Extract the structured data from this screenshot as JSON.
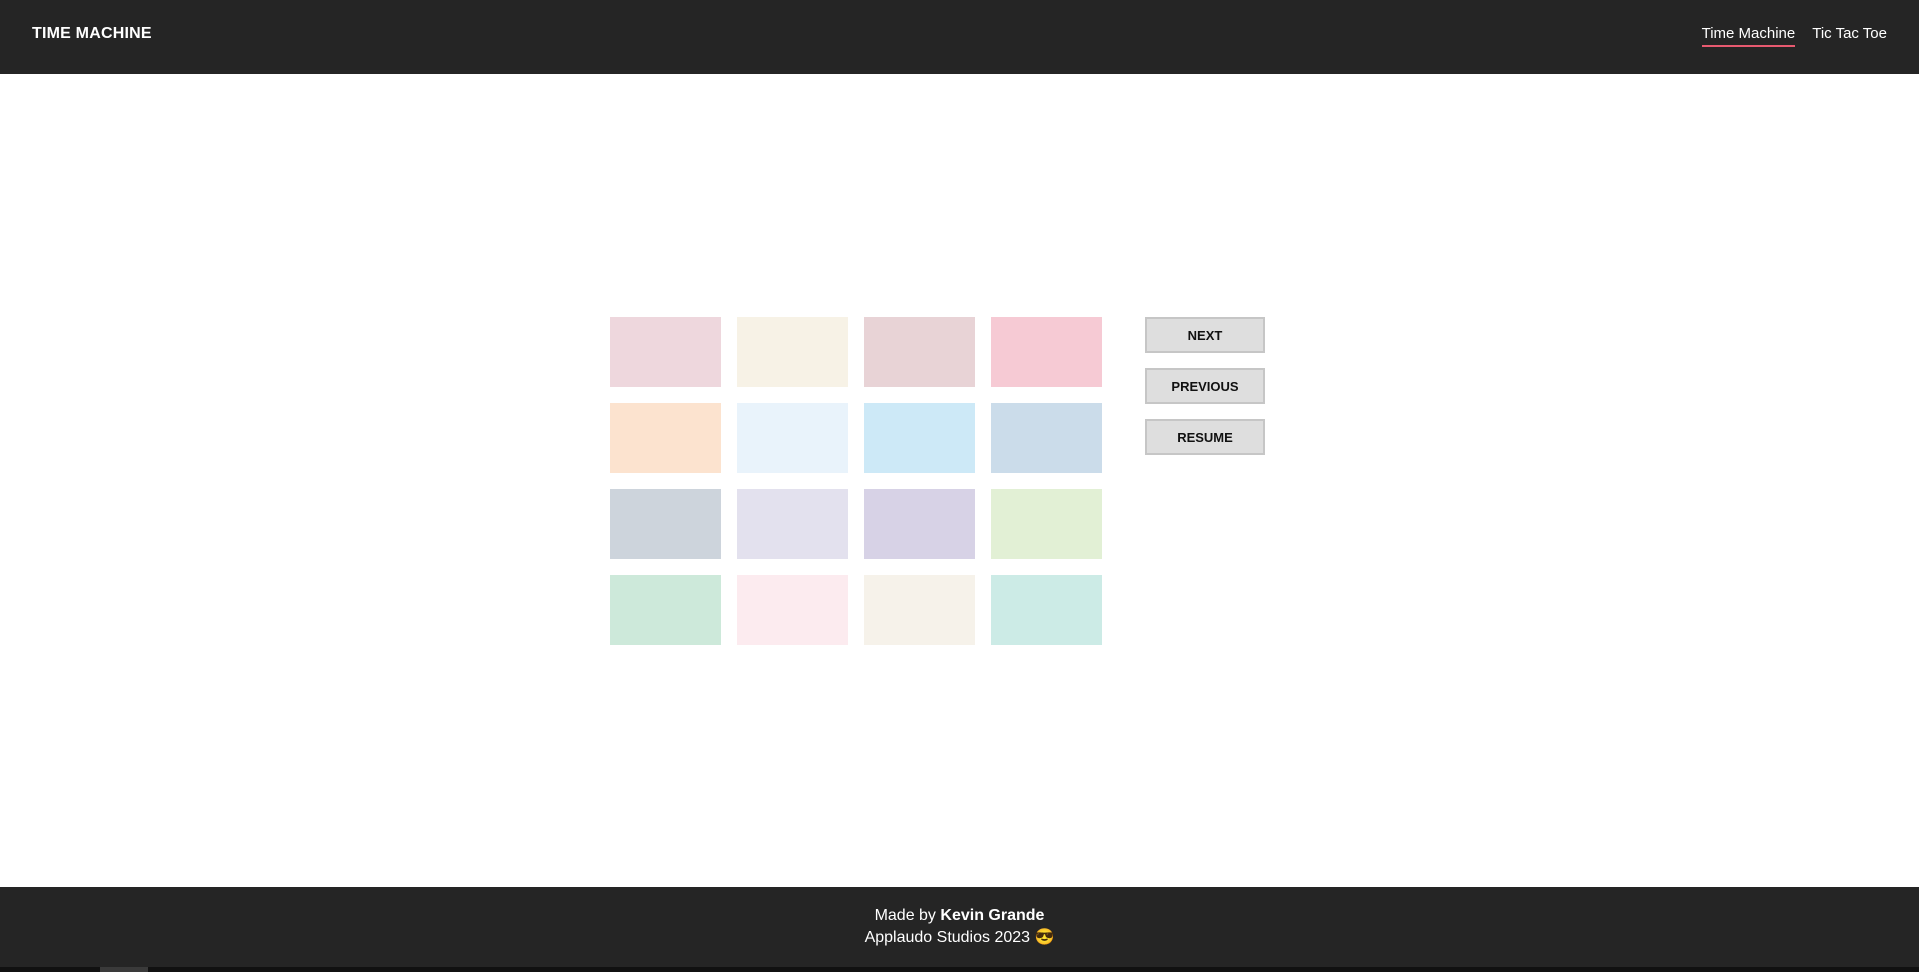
{
  "header": {
    "brand": "TIME MACHINE",
    "nav": [
      {
        "label": "Time Machine",
        "active": true
      },
      {
        "label": "Tic Tac Toe",
        "active": false
      }
    ],
    "active_underline_color": "#e85a70"
  },
  "grid": {
    "tiles": [
      {
        "color": "#eed7dd"
      },
      {
        "color": "#f7f2e6"
      },
      {
        "color": "#e8d3d6"
      },
      {
        "color": "#f6cad4"
      },
      {
        "color": "#fce3cf"
      },
      {
        "color": "#e9f3fb"
      },
      {
        "color": "#cde9f7"
      },
      {
        "color": "#cbdcea"
      },
      {
        "color": "#cdd4dc"
      },
      {
        "color": "#e3e1ee"
      },
      {
        "color": "#d7d2e6"
      },
      {
        "color": "#e2f0d5"
      },
      {
        "color": "#cde9da"
      },
      {
        "color": "#fcebef"
      },
      {
        "color": "#f6f2ea"
      },
      {
        "color": "#ccebe6"
      }
    ]
  },
  "controls": {
    "next_label": "NEXT",
    "previous_label": "PREVIOUS",
    "resume_label": "RESUME"
  },
  "footer": {
    "made_by_prefix": "Made by",
    "author": "Kevin Grande",
    "studio": "Applaudo Studios 2023 😎"
  }
}
